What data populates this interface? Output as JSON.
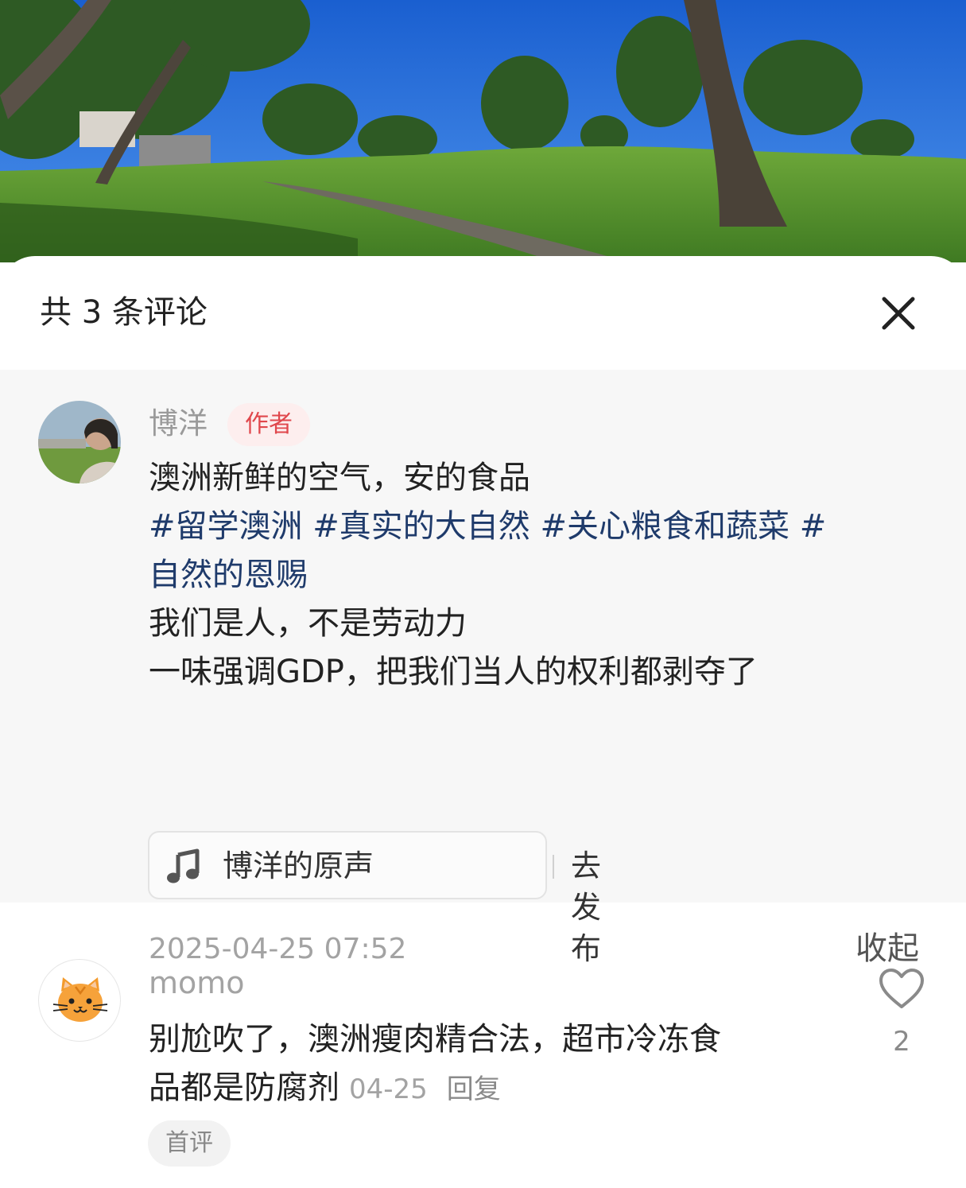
{
  "comments_header": {
    "title": "共 3 条评论"
  },
  "author_comment": {
    "username": "博洋",
    "badge": "作者",
    "line1": "澳洲新鲜的空气，安的食品",
    "tags_line1": "#留学澳洲 #真实的大自然 #关心粮食和蔬菜 #",
    "tags_line2": "自然的恩赐",
    "line4": "我们是人，不是劳动力",
    "line5": "一味强调GDP，把我们当人的权利都剥夺了",
    "music_label": "博洋的原声",
    "music_action": "去发布",
    "timestamp": "2025-04-25 07:52",
    "collapse_label": "收起"
  },
  "reply_comment": {
    "username": "momo",
    "text_line1": "别尬吹了，澳洲瘦肉精合法，超市冷冻食",
    "text_line2": "品都是防腐剂",
    "date": "04-25",
    "reply_label": "回复",
    "first_tag": "首评",
    "like_count": "2"
  },
  "icons": {
    "close": "close-icon",
    "music": "music-note-icon",
    "like": "heart-outline-icon",
    "cat_avatar": "cat-face-icon"
  },
  "colors": {
    "hashtag": "#1f3b6b",
    "author_badge_text": "#e0474c",
    "author_badge_bg": "#fdeeee",
    "author_block_bg": "#f7f7f7"
  }
}
